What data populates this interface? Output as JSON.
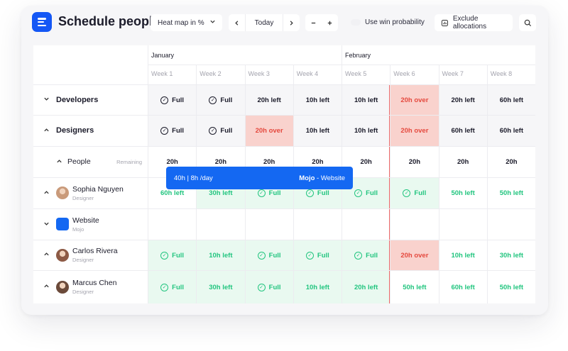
{
  "app": {
    "title": "Schedule people",
    "logo_icon": "list-icon",
    "accent": "#1457f5"
  },
  "toolbar": {
    "view_select": "Heat map in %",
    "today": "Today",
    "win_probability_label": "Use win probability",
    "exclude_label": "Exclude allocations"
  },
  "grid": {
    "months": [
      "January",
      "February"
    ],
    "weeks": [
      "Week 1",
      "Week 2",
      "Week 3",
      "Week 4",
      "Week 5",
      "Week 6",
      "Week 7",
      "Week 8"
    ],
    "colors": {
      "full_green_bg": "#e9f9f0",
      "full_green_text": "#22c57f",
      "over_bg": "#f9d2cd",
      "over_text": "#e5493e",
      "neutral_bg": "#f6f6f8",
      "today_line": "#ee6b6b"
    },
    "rows": [
      {
        "type": "group",
        "label": "Developers",
        "expanded": false,
        "cells": [
          {
            "text": "Full",
            "status": "full-neutral"
          },
          {
            "text": "Full",
            "status": "full-neutral"
          },
          {
            "text": "20h left",
            "status": "neutral"
          },
          {
            "text": "10h left",
            "status": "neutral"
          },
          {
            "text": "10h left",
            "status": "neutral"
          },
          {
            "text": "20h over",
            "status": "over"
          },
          {
            "text": "20h left",
            "status": "neutral"
          },
          {
            "text": "60h left",
            "status": "neutral"
          }
        ]
      },
      {
        "type": "group",
        "label": "Designers",
        "expanded": true,
        "cells": [
          {
            "text": "Full",
            "status": "full-neutral"
          },
          {
            "text": "Full",
            "status": "full-neutral"
          },
          {
            "text": "20h over",
            "status": "over"
          },
          {
            "text": "10h left",
            "status": "neutral"
          },
          {
            "text": "10h left",
            "status": "neutral"
          },
          {
            "text": "20h over",
            "status": "over"
          },
          {
            "text": "60h left",
            "status": "neutral"
          },
          {
            "text": "60h left",
            "status": "neutral"
          }
        ]
      },
      {
        "type": "subgroup",
        "label": "People",
        "meta": "Remaining",
        "cells": [
          {
            "text": "20h",
            "status": "neutral"
          },
          {
            "text": "20h",
            "status": "neutral"
          },
          {
            "text": "20h",
            "status": "neutral"
          },
          {
            "text": "20h",
            "status": "neutral"
          },
          {
            "text": "20h",
            "status": "neutral"
          },
          {
            "text": "20h",
            "status": "neutral"
          },
          {
            "text": "20h",
            "status": "neutral"
          },
          {
            "text": "20h",
            "status": "neutral"
          }
        ]
      },
      {
        "type": "person",
        "name": "Sophia Nguyen",
        "role": "Designer",
        "avatar_color": "#c99a7a",
        "cells": [
          {
            "text": "60h left",
            "status": "green-light"
          },
          {
            "text": "30h left",
            "status": "green"
          },
          {
            "text": "Full",
            "status": "full-green"
          },
          {
            "text": "Full",
            "status": "full-green"
          },
          {
            "text": "Full",
            "status": "full-green"
          },
          {
            "text": "Full",
            "status": "full-green"
          },
          {
            "text": "50h left",
            "status": "green-light"
          },
          {
            "text": "50h left",
            "status": "green-light"
          }
        ]
      },
      {
        "type": "project",
        "name": "Website",
        "client": "Mojo",
        "color": "#1468f2",
        "booking": {
          "label": "40h | 8h /day",
          "project": "Mojo",
          "suffix": "- Website"
        }
      },
      {
        "type": "person",
        "name": "Carlos Rivera",
        "role": "Designer",
        "avatar_color": "#8d5a45",
        "cells": [
          {
            "text": "Full",
            "status": "full-green"
          },
          {
            "text": "10h left",
            "status": "green"
          },
          {
            "text": "Full",
            "status": "full-green"
          },
          {
            "text": "Full",
            "status": "full-green"
          },
          {
            "text": "Full",
            "status": "full-green"
          },
          {
            "text": "20h over",
            "status": "over"
          },
          {
            "text": "10h left",
            "status": "green-light"
          },
          {
            "text": "30h left",
            "status": "green-light"
          }
        ]
      },
      {
        "type": "person",
        "name": "Marcus Chen",
        "role": "Designer",
        "avatar_color": "#6b4a3a",
        "cells": [
          {
            "text": "Full",
            "status": "full-green"
          },
          {
            "text": "30h left",
            "status": "green"
          },
          {
            "text": "Full",
            "status": "full-green"
          },
          {
            "text": "10h left",
            "status": "green"
          },
          {
            "text": "20h left",
            "status": "green"
          },
          {
            "text": "50h left",
            "status": "green-light"
          },
          {
            "text": "60h left",
            "status": "green-light"
          },
          {
            "text": "50h left",
            "status": "green-light"
          }
        ]
      }
    ]
  }
}
